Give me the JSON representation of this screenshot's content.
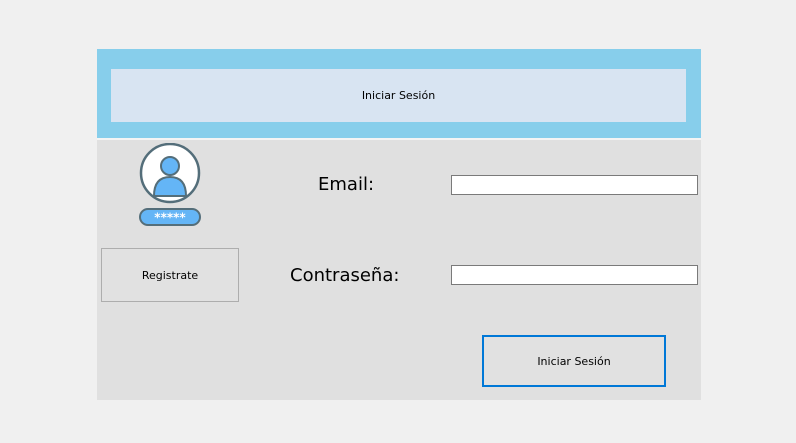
{
  "header": {
    "title": "Iniciar Sesión"
  },
  "avatar": {
    "icon": "user-password-icon",
    "password_mask": "*****"
  },
  "register_button": {
    "label": "Registrate"
  },
  "email": {
    "label": "Email:",
    "value": ""
  },
  "password": {
    "label": "Contraseña:",
    "value": ""
  },
  "login_button": {
    "label": "Iniciar Sesión"
  },
  "colors": {
    "header_band": "#87ceeb",
    "header_panel": "#d8e4f2",
    "form_background": "#e0e0e0",
    "focus_border": "#0078d7",
    "icon_blue": "#64b5f6",
    "icon_outline": "#546e7a"
  }
}
